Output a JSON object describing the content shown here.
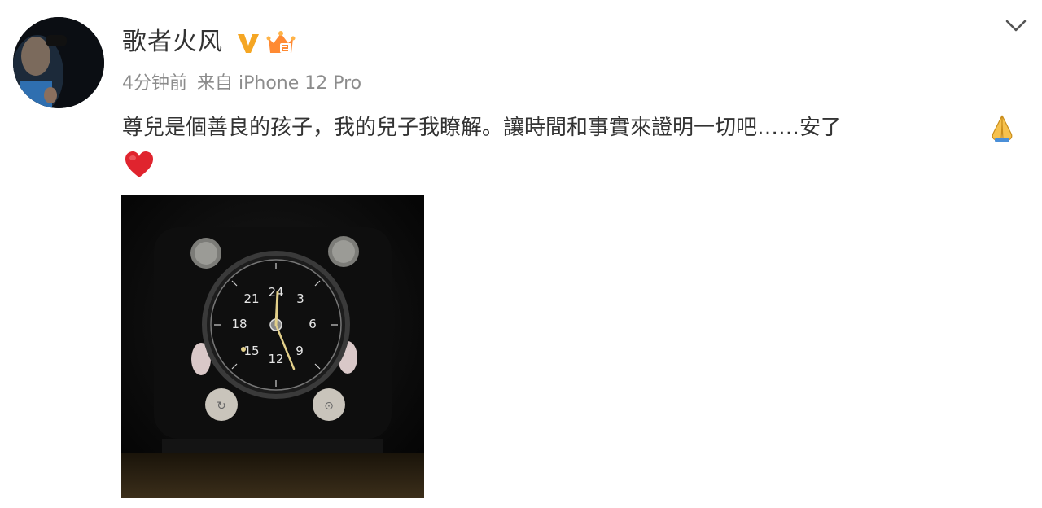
{
  "post": {
    "author": {
      "name": "歌者火风",
      "avatar_icon": "singer-avatar",
      "badges": [
        "verified-v-icon",
        "vip-member-icon"
      ],
      "verified_color": "#f5a623",
      "vip_color": "#ff8a33"
    },
    "meta": {
      "time": "4分钟前",
      "source": "来自 iPhone 12 Pro"
    },
    "text": "尊兒是個善良的孩子，我的兒子我瞭解。讓時間和事實來證明一切吧……安了",
    "emojis": [
      "pray-icon",
      "red-heart-icon"
    ],
    "heart_color": "#e0242e",
    "image": {
      "subject": "dark-photo-of-analog-clock",
      "dial_numbers": [
        "24",
        "3",
        "6",
        "9",
        "12",
        "15",
        "18",
        "21"
      ]
    },
    "menu_icon": "chevron-down-icon"
  }
}
